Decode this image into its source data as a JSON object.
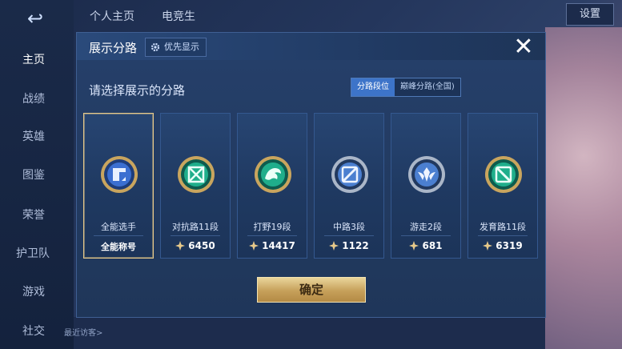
{
  "background": {
    "sidebar_items": [
      "主页",
      "战绩",
      "英雄",
      "图鉴",
      "荣誉",
      "护卫队",
      "游戏",
      "社交"
    ],
    "top_tabs": [
      "个人主页",
      "电竞生"
    ],
    "settings_label": "设置",
    "recent_visitors": "最近访客>"
  },
  "modal": {
    "title": "展示分路",
    "priority_label": "优先显示",
    "subtitle": "请选择展示的分路",
    "toggle": [
      "分路段位",
      "巅峰分路(全国)"
    ],
    "confirm_label": "确定",
    "cards": [
      {
        "label": "全能选手",
        "value": "全能称号",
        "badge": "all-round",
        "accent": "#3b6fd1"
      },
      {
        "label": "对抗路11段",
        "value": "6450",
        "badge": "clash-lane",
        "accent": "#1fae8b"
      },
      {
        "label": "打野19段",
        "value": "14417",
        "badge": "jungle",
        "accent": "#1fae8b"
      },
      {
        "label": "中路3段",
        "value": "1122",
        "badge": "mid-lane",
        "accent": "#4b7fd0"
      },
      {
        "label": "游走2段",
        "value": "681",
        "badge": "roam",
        "accent": "#4b7fd0"
      },
      {
        "label": "发育路11段",
        "value": "6319",
        "badge": "farm-lane",
        "accent": "#1fae8b"
      }
    ]
  },
  "colors": {
    "gold": "#e7c98a",
    "selected_toggle": "#3d74c9"
  }
}
